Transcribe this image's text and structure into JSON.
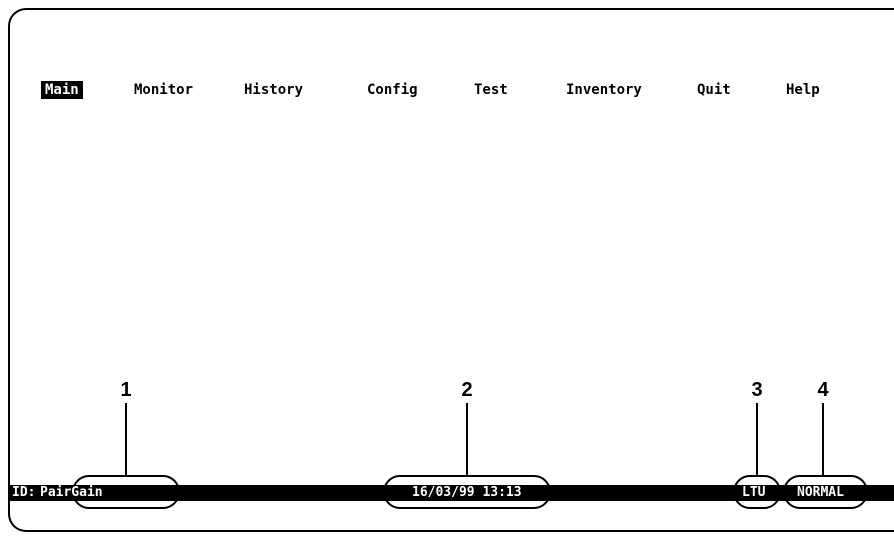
{
  "menu": {
    "items": [
      {
        "label": "Main",
        "active": true
      },
      {
        "label": "Monitor",
        "active": false
      },
      {
        "label": "History",
        "active": false
      },
      {
        "label": "Config",
        "active": false
      },
      {
        "label": "Test",
        "active": false
      },
      {
        "label": "Inventory",
        "active": false
      },
      {
        "label": "Quit",
        "active": false
      },
      {
        "label": "Help",
        "active": false
      }
    ]
  },
  "status_bar": {
    "id_prefix": "ID:",
    "system_id": "PairGain",
    "datetime": "16/03/99 13:13",
    "unit": "LTU",
    "mode": "NORMAL"
  },
  "callouts": [
    "1",
    "2",
    "3",
    "4"
  ],
  "colors": {
    "background": "#ffffff",
    "foreground": "#000000",
    "status_text": "#ffffff"
  }
}
